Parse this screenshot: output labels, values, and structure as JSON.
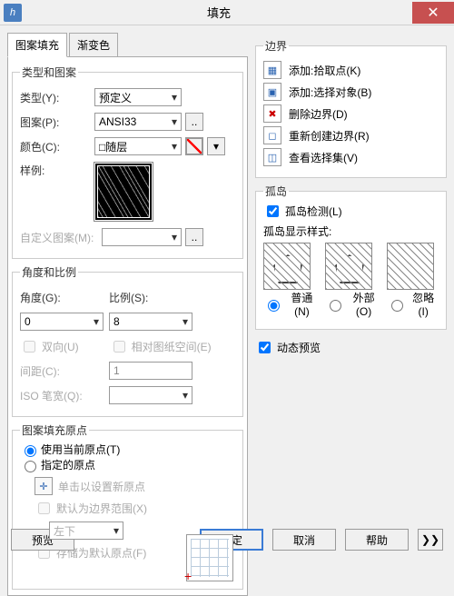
{
  "window": {
    "title": "填充"
  },
  "tabs": {
    "hatch": "图案填充",
    "gradient": "渐变色"
  },
  "typePattern": {
    "legend": "类型和图案",
    "type_lbl": "类型(Y):",
    "type_val": "预定义",
    "pattern_lbl": "图案(P):",
    "pattern_val": "ANSI33",
    "color_lbl": "颜色(C):",
    "color_val": "□随层",
    "sample_lbl": "样例:",
    "custom_lbl": "自定义图案(M):"
  },
  "angleScale": {
    "legend": "角度和比例",
    "angle_lbl": "角度(G):",
    "angle_val": "0",
    "scale_lbl": "比例(S):",
    "scale_val": "8",
    "double_lbl": "双向(U)",
    "rel_paper_lbl": "相对图纸空间(E)",
    "spacing_lbl": "间距(C):",
    "spacing_val": "1",
    "iso_lbl": "ISO 笔宽(Q):"
  },
  "origin": {
    "legend": "图案填充原点",
    "use_current": "使用当前原点(T)",
    "specified": "指定的原点",
    "click_new": "单击以设置新原点",
    "default_bound": "默认为边界范围(X)",
    "pos_val": "左下",
    "store": "存储为默认原点(F)"
  },
  "boundary": {
    "legend": "边界",
    "add_pick": "添加:拾取点(K)",
    "add_select": "添加:选择对象(B)",
    "del_bound": "删除边界(D)",
    "recreate": "重新创建边界(R)",
    "view_sel": "查看选择集(V)"
  },
  "islands": {
    "legend": "孤岛",
    "detect": "孤岛检测(L)",
    "style_lbl": "孤岛显示样式:",
    "normal": "普通(N)",
    "outer": "外部(O)",
    "ignore": "忽略(I)"
  },
  "dynamic_preview": "动态预览",
  "buttons": {
    "preview": "预览",
    "ok": "确定",
    "cancel": "取消",
    "help": "帮助"
  }
}
